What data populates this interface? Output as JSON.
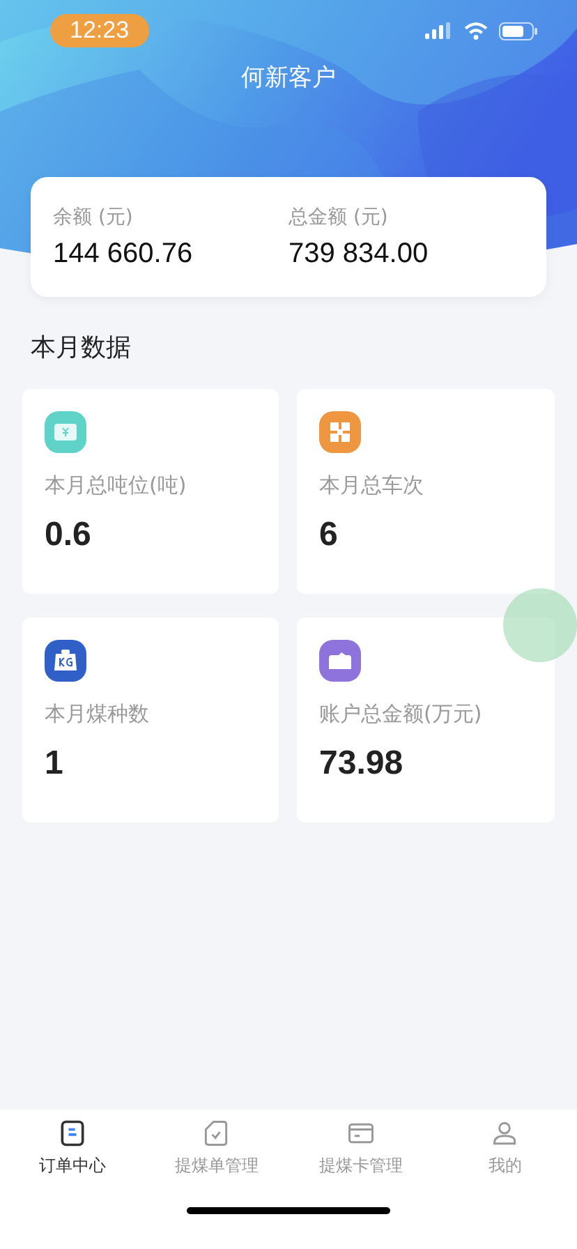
{
  "status_bar": {
    "time": "12:23"
  },
  "title": "何新客户",
  "balance_card": [
    {
      "label": "余额 (元)",
      "value": "144 660.76"
    },
    {
      "label": "总金额 (元)",
      "value": "739 834.00"
    }
  ],
  "section_title": "本月数据",
  "stats": [
    {
      "kind": "wallet",
      "color": "#5fd3c8",
      "label": "本月总吨位(吨)",
      "value": "0.6"
    },
    {
      "kind": "grid",
      "color": "#ef9640",
      "label": "本月总车次",
      "value": "6"
    },
    {
      "kind": "weight",
      "color": "#2f5fc7",
      "label": "本月煤种数",
      "value": "1"
    },
    {
      "kind": "truck",
      "color": "#8f73dc",
      "label": "账户总金额(万元)",
      "value": "73.98"
    }
  ],
  "tabs": [
    {
      "kind": "order",
      "label": "订单中心",
      "selected": true
    },
    {
      "kind": "bill",
      "label": "提煤单管理",
      "selected": false
    },
    {
      "kind": "card",
      "label": "提煤卡管理",
      "selected": false
    },
    {
      "kind": "user",
      "label": "我的",
      "selected": false
    }
  ]
}
